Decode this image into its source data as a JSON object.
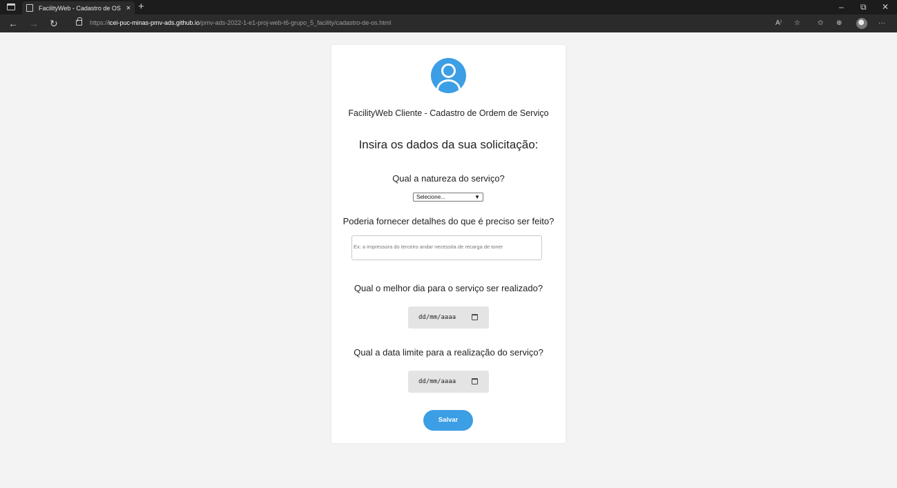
{
  "browser": {
    "tab_title": "FacilityWeb - Cadastro de OS",
    "tab_close": "×",
    "new_tab": "+",
    "url_prefix": "https://",
    "url_host": "icei-puc-minas-pmv-ads.github.io",
    "url_path": "/pmv-ads-2022-1-e1-proj-web-t6-grupo_5_facility/cadastro-de-os.html",
    "window_controls": {
      "minimize": "–",
      "restore": "⧉",
      "close": "✕"
    },
    "nav": {
      "back": "←",
      "forward": "→",
      "refresh": "↻"
    },
    "toolbar_icons": {
      "read_aloud": "A⁾",
      "favorites_add": "☆",
      "favorites": "✩",
      "collections": "⊕",
      "more": "···"
    }
  },
  "form": {
    "subtitle": "FacilityWeb Cliente - Cadastro de Ordem de Serviço",
    "heading": "Insira os dados da sua solicitação:",
    "q_nature": "Qual a natureza do serviço?",
    "select_value": "Selecione...",
    "q_details": "Poderia fornecer detalhes do que é preciso ser feito?",
    "details_placeholder": "Ex: a impressora do terceiro andar necessita de recarga de toner",
    "q_best_day": "Qual o melhor dia para o serviço ser realizado?",
    "date_placeholder": "dd/mm/aaaa",
    "q_deadline": "Qual a data limite para a realização do serviço?",
    "save_label": "Salvar"
  },
  "colors": {
    "accent": "#3c9ee5",
    "page_bg": "#f3f3f3",
    "date_bg": "#e4e4e4"
  }
}
